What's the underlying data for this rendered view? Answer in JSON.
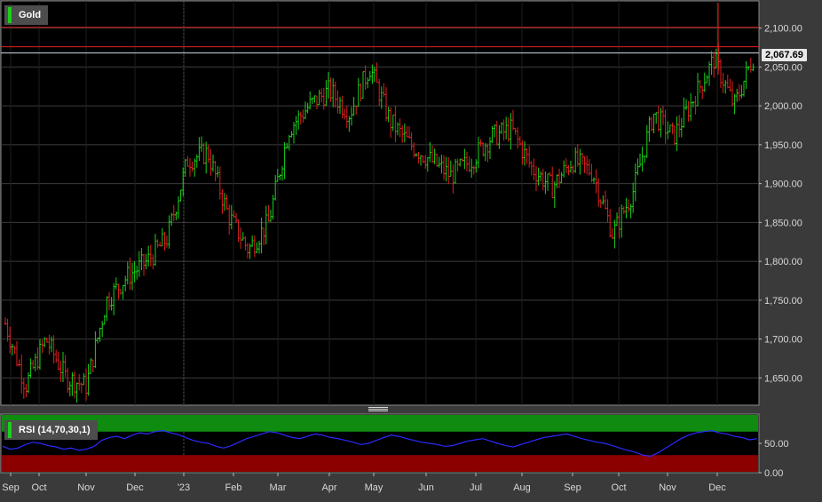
{
  "chart_data": [
    {
      "type": "ohlc",
      "title": "Gold",
      "legend": "Gold",
      "series_color_up": "#19d219",
      "series_color_down": "#e02020",
      "x_tick_labels": [
        "Sep",
        "Oct",
        "Nov",
        "Dec",
        "'23",
        "Feb",
        "Mar",
        "Apr",
        "May",
        "Jun",
        "Jul",
        "Aug",
        "Sep",
        "Oct",
        "Nov",
        "Dec"
      ],
      "y_tick_labels": [
        "1,650.00",
        "1,700.00",
        "1,750.00",
        "1,800.00",
        "1,850.00",
        "1,900.00",
        "1,950.00",
        "2,000.00",
        "2,050.00",
        "2,100.00"
      ],
      "ylim": [
        1615,
        2135
      ],
      "grid": true,
      "last_value": 2067.69,
      "last_value_label": "2,067.69",
      "horizontal_lines": [
        {
          "value": 2101,
          "color": "#e02020"
        },
        {
          "value": 2076,
          "color": "#e02020"
        },
        {
          "value": 2068,
          "color": "#cfd8e8"
        }
      ],
      "monthly_points": [
        {
          "x": "Sep",
          "y": 1720
        },
        {
          "x": "Oct",
          "y": 1640
        },
        {
          "x": "Oct",
          "y": 1700
        },
        {
          "x": "Oct",
          "y": 1650
        },
        {
          "x": "Nov",
          "y": 1640
        },
        {
          "x": "Nov",
          "y": 1750
        },
        {
          "x": "Dec",
          "y": 1780
        },
        {
          "x": "Dec",
          "y": 1800
        },
        {
          "x": "'23",
          "y": 1830
        },
        {
          "x": "'23",
          "y": 1930
        },
        {
          "x": "Feb",
          "y": 1940
        },
        {
          "x": "Feb",
          "y": 1860
        },
        {
          "x": "Mar",
          "y": 1815
        },
        {
          "x": "Mar",
          "y": 1850
        },
        {
          "x": "Mar",
          "y": 1970
        },
        {
          "x": "Apr",
          "y": 2000
        },
        {
          "x": "Apr",
          "y": 2020
        },
        {
          "x": "May",
          "y": 1990
        },
        {
          "x": "May",
          "y": 2050
        },
        {
          "x": "May",
          "y": 1980
        },
        {
          "x": "Jun",
          "y": 1950
        },
        {
          "x": "Jun",
          "y": 1930
        },
        {
          "x": "Jul",
          "y": 1910
        },
        {
          "x": "Jul",
          "y": 1930
        },
        {
          "x": "Jul",
          "y": 1960
        },
        {
          "x": "Aug",
          "y": 1970
        },
        {
          "x": "Aug",
          "y": 1920
        },
        {
          "x": "Aug",
          "y": 1895
        },
        {
          "x": "Sep",
          "y": 1930
        },
        {
          "x": "Sep",
          "y": 1915
        },
        {
          "x": "Oct",
          "y": 1835
        },
        {
          "x": "Oct",
          "y": 1890
        },
        {
          "x": "Oct",
          "y": 1990
        },
        {
          "x": "Nov",
          "y": 1960
        },
        {
          "x": "Nov",
          "y": 2010
        },
        {
          "x": "Dec",
          "y": 2060
        },
        {
          "x": "Dec",
          "y": 2000
        },
        {
          "x": "Dec",
          "y": 2068
        }
      ]
    },
    {
      "type": "line",
      "title": "RSI (14,70,30,1)",
      "legend": "RSI (14,70,30,1)",
      "line_color": "#2a2aff",
      "upper_band": 70,
      "lower_band": 30,
      "upper_band_color": "#0f8c0f",
      "lower_band_color": "#8c0000",
      "y_tick_labels": [
        "0.00",
        "50.00"
      ],
      "ylim": [
        0,
        100
      ],
      "values": [
        45,
        40,
        42,
        48,
        52,
        50,
        46,
        44,
        40,
        42,
        38,
        40,
        45,
        55,
        60,
        62,
        58,
        64,
        68,
        66,
        70,
        72,
        68,
        65,
        60,
        55,
        52,
        50,
        45,
        42,
        46,
        52,
        58,
        62,
        66,
        70,
        68,
        64,
        60,
        58,
        62,
        66,
        64,
        60,
        58,
        55,
        52,
        48,
        50,
        55,
        60,
        64,
        62,
        58,
        55,
        52,
        50,
        48,
        45,
        46,
        50,
        54,
        56,
        58,
        54,
        50,
        46,
        44,
        48,
        52,
        56,
        60,
        62,
        64,
        66,
        62,
        58,
        55,
        52,
        50,
        46,
        42,
        38,
        35,
        30,
        28,
        34,
        42,
        50,
        58,
        64,
        68,
        70,
        72,
        68,
        66,
        62,
        60,
        56,
        58
      ]
    }
  ]
}
